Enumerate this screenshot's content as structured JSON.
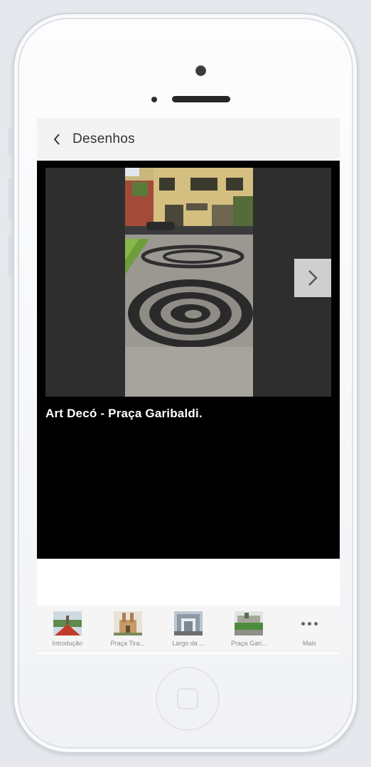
{
  "nav": {
    "back_icon": "chevron-left-icon",
    "title": "Desenhos"
  },
  "slide": {
    "caption": "Art Decó - Praça Garibaldi.",
    "next_icon": "chevron-right-icon"
  },
  "tabs": [
    {
      "label": "Introdução",
      "icon": "thumbnail-red-plaza"
    },
    {
      "label": "Praça Tira...",
      "icon": "thumbnail-church"
    },
    {
      "label": "Largo da ...",
      "icon": "thumbnail-building"
    },
    {
      "label": "Praça Gari...",
      "icon": "thumbnail-green-square"
    },
    {
      "label": "Mais",
      "icon": "more-dots-icon"
    }
  ],
  "device": {
    "home_button": "home-button"
  }
}
